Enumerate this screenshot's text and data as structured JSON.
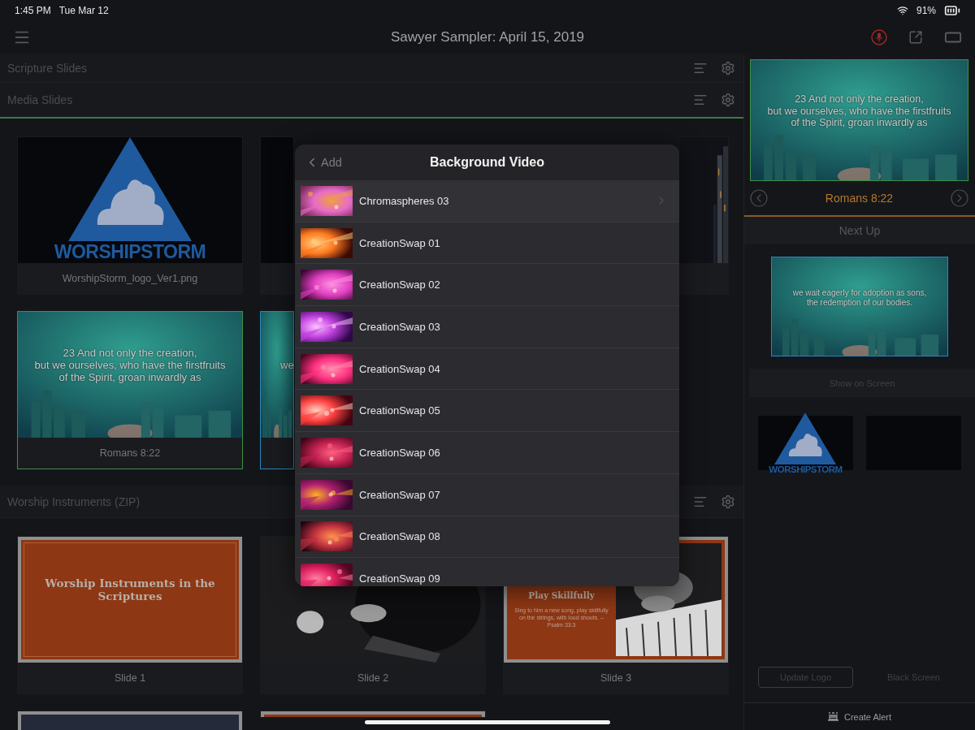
{
  "status_bar": {
    "time": "1:45 PM",
    "date": "Tue Mar 12",
    "battery": "91%"
  },
  "nav": {
    "title": "Sawyer Sampler: April 15, 2019"
  },
  "sections": [
    {
      "title": "Scripture Slides",
      "selected": false
    },
    {
      "title": "Media Slides",
      "selected": true,
      "cards": [
        {
          "kind": "logo",
          "logo": "WORSHIPSTORM",
          "caption": "WorshipStorm_logo_Ver1.png",
          "live": false,
          "next": false
        },
        {
          "kind": "blank",
          "live": false,
          "next": false
        },
        {
          "kind": "night",
          "live": false,
          "next": false
        },
        {
          "kind": "scripture",
          "text": "23 And not only the creation,\nbut we ourselves, who have the firstfruits\nof the Spirit, groan inwardly as",
          "caption": "Romans 8:22",
          "live": true,
          "next": false
        },
        {
          "kind": "scripture_cut",
          "text": "we",
          "live": false,
          "next": true
        }
      ]
    },
    {
      "title": "Worship Instruments (ZIP)",
      "selected": false,
      "cards": [
        {
          "kind": "title_slide",
          "title": "Worship Instruments in the Scriptures",
          "caption": "Slide 1",
          "live": false,
          "next": false
        },
        {
          "caption": "Slide 2",
          "live": false,
          "next": false
        },
        {
          "kind": "split_slide",
          "title": "Play Skillfully",
          "body": "Sing to him a new song, play skillfully on the strings, with loud shouts. – Psalm 33:3",
          "caption": "Slide 3",
          "live": false,
          "next": false
        },
        {
          "kind": "navy_slide",
          "live": false,
          "next": false
        },
        {
          "kind": "photo_slide",
          "live": false,
          "next": false
        }
      ]
    }
  ],
  "modal": {
    "back": "Add",
    "title": "Background Video",
    "items": [
      {
        "label": "Chromaspheres 03",
        "selected": true
      },
      {
        "label": "CreationSwap 01",
        "selected": false
      },
      {
        "label": "CreationSwap 02",
        "selected": false
      },
      {
        "label": "CreationSwap 03",
        "selected": false
      },
      {
        "label": "CreationSwap 04",
        "selected": false
      },
      {
        "label": "CreationSwap 05",
        "selected": false
      },
      {
        "label": "CreationSwap 06",
        "selected": false
      },
      {
        "label": "CreationSwap 07",
        "selected": false
      },
      {
        "label": "CreationSwap 08",
        "selected": false
      },
      {
        "label": "CreationSwap 09",
        "selected": false
      }
    ]
  },
  "live": {
    "text": "23 And not only the creation,\nbut we ourselves, who have the firstfruits\nof the Spirit, groan inwardly as",
    "reference": "Romans 8:22"
  },
  "next_header": "Next Up",
  "next": {
    "text": "we wait eagerly for adoption as sons,\nthe redemption of our bodies."
  },
  "show_button": "Show on Screen",
  "thumbnails": [
    {
      "kind": "logo",
      "logo": "WORSHIPSTORM"
    },
    {
      "kind": "blank"
    }
  ],
  "buttons": [
    {
      "label": "Update Logo",
      "kind": "outlined"
    },
    {
      "label": "Black Screen",
      "kind": "plain"
    }
  ],
  "alert": "Create Alert"
}
